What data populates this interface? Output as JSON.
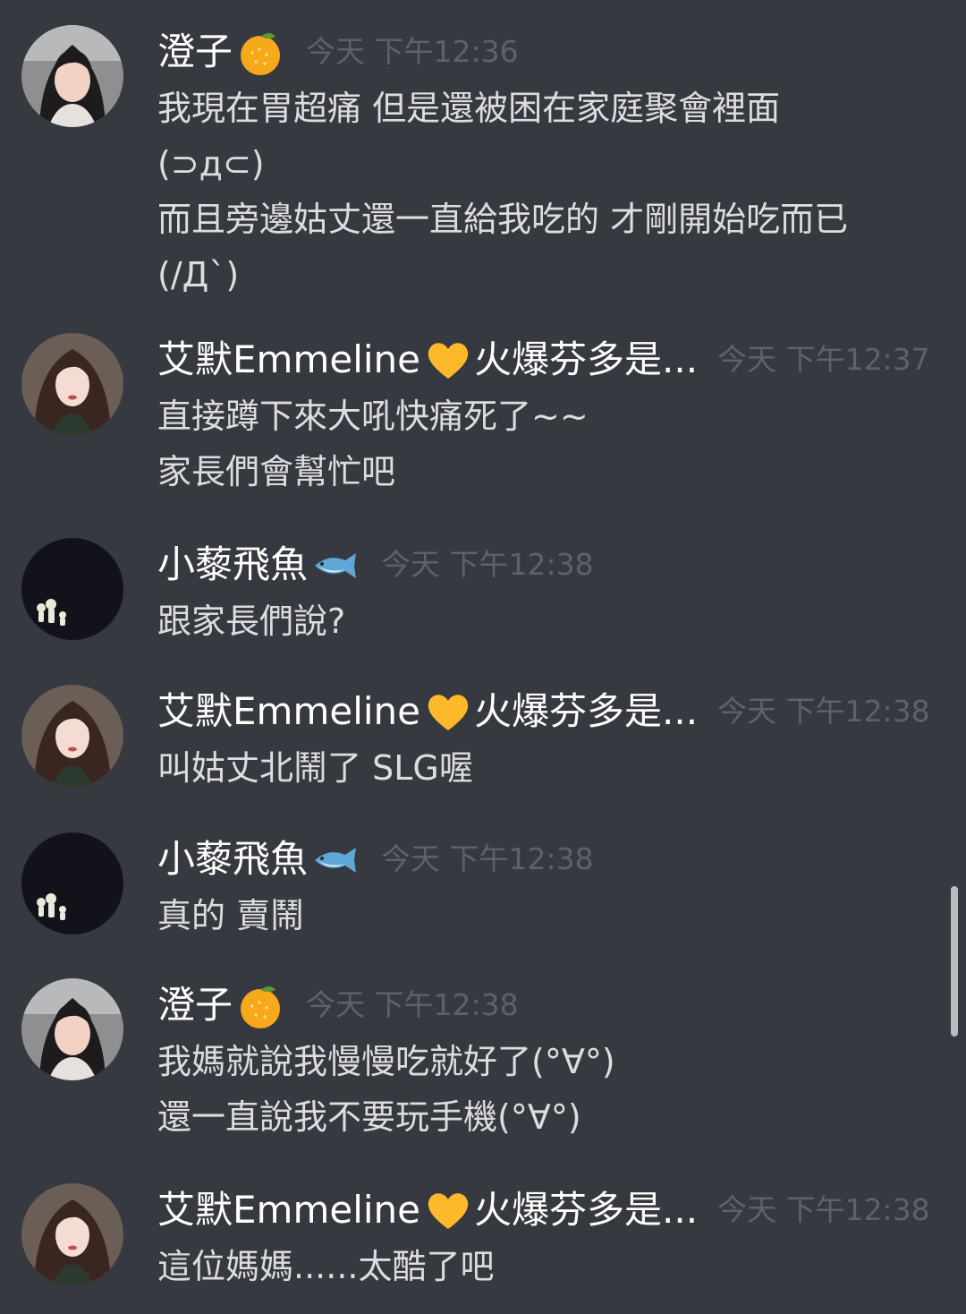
{
  "messages": [
    {
      "author": "澄子",
      "badge": "tangerine-emoji",
      "avatar": "girl-portrait-avatar",
      "timestamp": "今天 下午12:36",
      "lines": [
        "我現在胃超痛 但是還被困在家庭聚會裡面",
        "(⊃д⊂)",
        "而且旁邊姑丈還一直給我吃的 才剛開始吃而已",
        "(/Д`)"
      ]
    },
    {
      "author": "艾默Emmeline",
      "badge": "yellow-heart-emoji",
      "author_suffix": "火爆芬多是...",
      "avatar": "long-hair-girl-avatar",
      "timestamp": "今天 下午12:37",
      "lines": [
        "直接蹲下來大吼快痛死了~~",
        "家長們會幫忙吧"
      ]
    },
    {
      "author": "小藜飛魚",
      "badge": "fish-emoji",
      "avatar": "kodama-figures-avatar",
      "timestamp": "今天 下午12:38",
      "lines": [
        "跟家長們說?"
      ]
    },
    {
      "author": "艾默Emmeline",
      "badge": "yellow-heart-emoji",
      "author_suffix": "火爆芬多是...",
      "avatar": "long-hair-girl-avatar",
      "timestamp": "今天 下午12:38",
      "lines": [
        "叫姑丈北鬧了 SLG喔"
      ]
    },
    {
      "author": "小藜飛魚",
      "badge": "fish-emoji",
      "avatar": "kodama-figures-avatar",
      "timestamp": "今天 下午12:38",
      "lines": [
        "真的 賣鬧"
      ]
    },
    {
      "author": "澄子",
      "badge": "tangerine-emoji",
      "avatar": "girl-portrait-avatar",
      "timestamp": "今天 下午12:38",
      "lines": [
        "我媽就說我慢慢吃就好了(°∀°)",
        "還一直說我不要玩手機(°∀°)"
      ]
    },
    {
      "author": "艾默Emmeline",
      "badge": "yellow-heart-emoji",
      "author_suffix": "火爆芬多是...",
      "avatar": "long-hair-girl-avatar",
      "timestamp": "今天 下午12:38",
      "lines": [
        "這位媽媽......太酷了吧"
      ]
    }
  ],
  "colors": {
    "background": "#36393f",
    "username": "#ffffff",
    "message_text": "#dcddde",
    "timestamp": "#5e6169"
  }
}
